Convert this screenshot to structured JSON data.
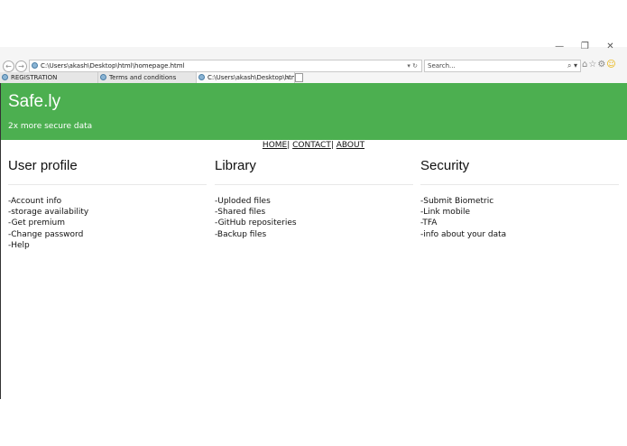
{
  "window": {
    "minimize": "—",
    "restore": "❐",
    "close": "✕"
  },
  "browser": {
    "back": "←",
    "forward": "→",
    "address": "C:\\Users\\akash\\Desktop\\html\\homepage.html",
    "address_controls": "▾ ↻",
    "search_placeholder": "Search...",
    "search_controls": "⌕ ▾",
    "tabs": [
      {
        "label": "REGISTRATION"
      },
      {
        "label": "Terms and conditions"
      },
      {
        "label": "C:\\Users\\akash\\Desktop\\htm...",
        "close": "×"
      }
    ]
  },
  "header": {
    "title": "Safe.ly",
    "tagline": "2x more secure data"
  },
  "nav": {
    "home": "HOME",
    "sep1": "| ",
    "contact": "CONTACT",
    "sep2": "| ",
    "about": "ABOUT"
  },
  "columns": [
    {
      "heading": "User profile",
      "items": [
        "-Account info",
        "-storage availability",
        "-Get premium",
        "-Change password",
        "-Help"
      ]
    },
    {
      "heading": "Library",
      "items": [
        "-Uploded files",
        "-Shared files",
        "-GitHub repositeries",
        "-Backup files"
      ]
    },
    {
      "heading": "Security",
      "items": [
        "-Submit Biometric",
        "-Link mobile",
        "-TFA",
        "-info about your data"
      ]
    }
  ],
  "colors": {
    "header_bg": "#4caf50"
  }
}
